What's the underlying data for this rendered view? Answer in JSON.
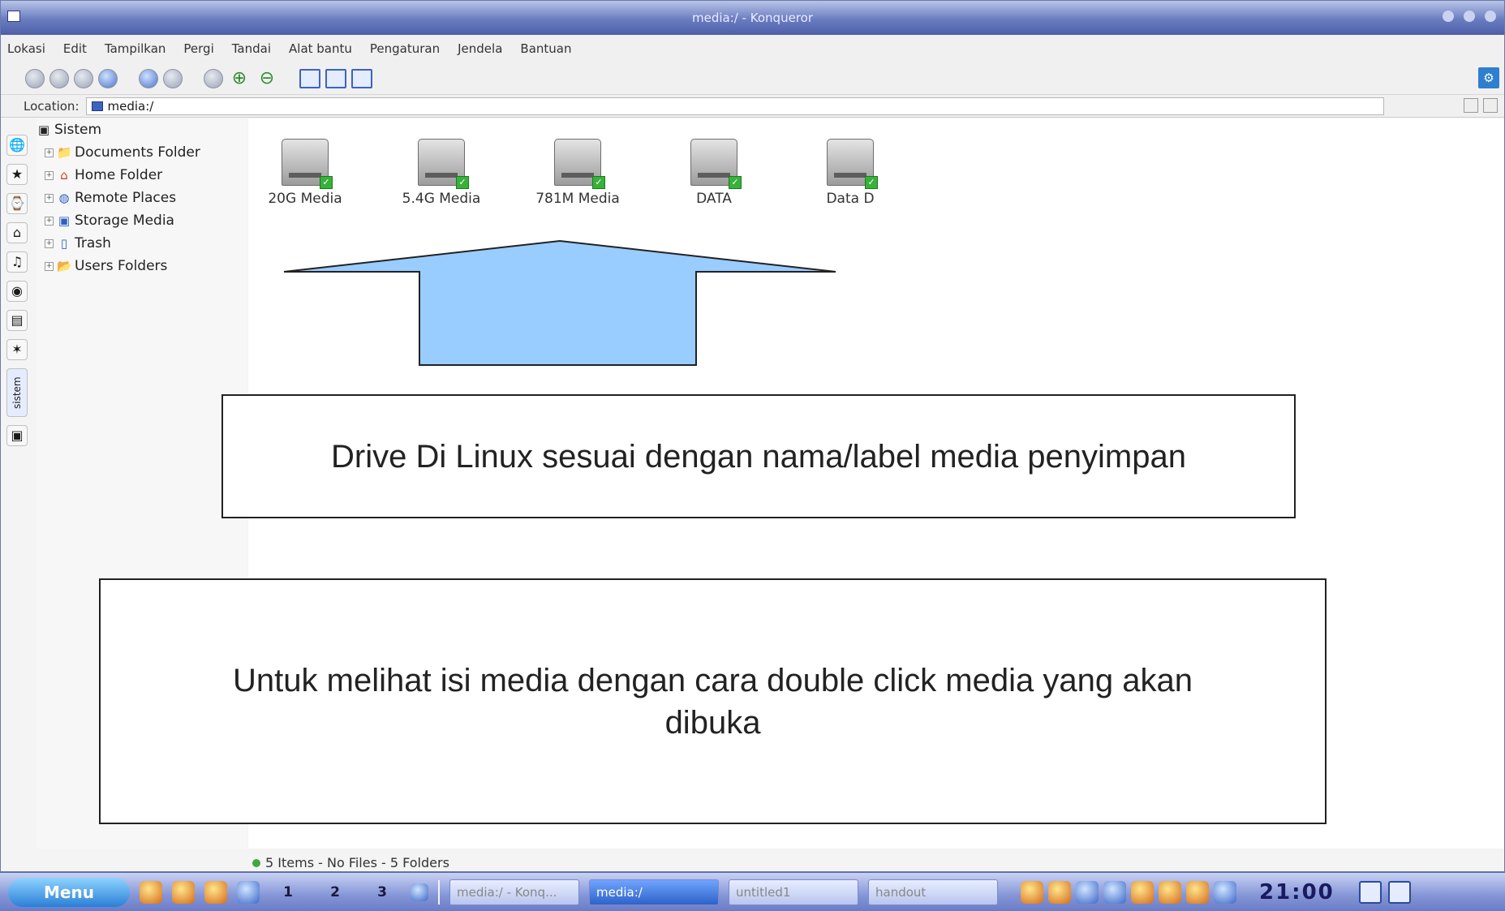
{
  "window": {
    "title": "media:/ - Konqueror"
  },
  "menubar": {
    "items": [
      "Lokasi",
      "Edit",
      "Tampilkan",
      "Pergi",
      "Tandai",
      "Alat bantu",
      "Pengaturan",
      "Jendela",
      "Bantuan"
    ]
  },
  "locationbar": {
    "label": "Location:",
    "value": "media:/"
  },
  "tree": {
    "root": "Sistem",
    "items": [
      {
        "label": "Documents Folder",
        "icon": "documents-folder-icon"
      },
      {
        "label": "Home Folder",
        "icon": "home-folder-icon"
      },
      {
        "label": "Remote Places",
        "icon": "remote-places-icon"
      },
      {
        "label": "Storage Media",
        "icon": "storage-media-icon"
      },
      {
        "label": "Trash",
        "icon": "trash-icon"
      },
      {
        "label": "Users Folders",
        "icon": "users-folders-icon"
      }
    ]
  },
  "sidebar": {
    "sistem_tab": "sistem"
  },
  "drives": [
    {
      "label": "20G Media"
    },
    {
      "label": "5.4G Media"
    },
    {
      "label": "781M Media"
    },
    {
      "label": "DATA"
    },
    {
      "label": "Data D"
    }
  ],
  "status": {
    "text": "5 Items - No Files - 5 Folders"
  },
  "callouts": {
    "drive_note": "Drive Di Linux sesuai dengan nama/label media penyimpan",
    "open_note": "Untuk melihat isi media dengan cara double click media yang akan dibuka"
  },
  "taskbar": {
    "menu_label": "Menu",
    "desktops": [
      "1",
      "2",
      "3"
    ],
    "tasks": [
      {
        "label": "media:/ - Konq...",
        "active": false
      },
      {
        "label": "media:/",
        "active": true
      },
      {
        "label": "untitled1",
        "active": false
      },
      {
        "label": "handout",
        "active": false
      }
    ],
    "clock": "21:00"
  },
  "colors": {
    "titlebar": "#6a7cc0",
    "taskbar": "#8495d6",
    "arrow_fill": "#99ccff",
    "callout_border": "#222222"
  }
}
